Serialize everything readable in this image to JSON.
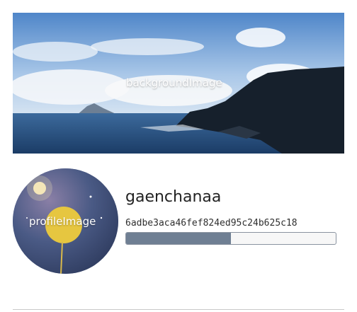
{
  "background_image": {
    "label": "backgroundImage"
  },
  "profile_image": {
    "label": "profileImage"
  },
  "user": {
    "name": "gaenchanaa",
    "id": "6adbe3aca46fef824ed95c24b625c18"
  },
  "progress": {
    "fraction": 0.5
  },
  "colors": {
    "progress_fill": "#6f7f93",
    "progress_border": "#8a93a0"
  }
}
